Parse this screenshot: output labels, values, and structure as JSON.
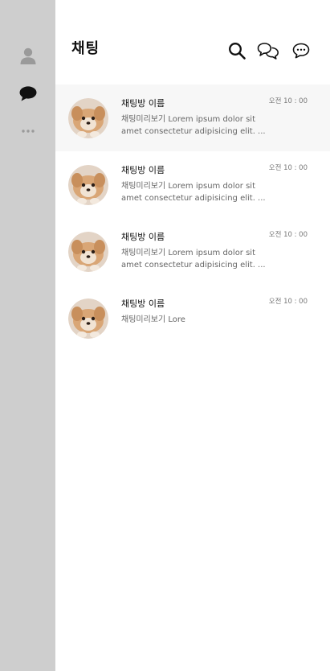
{
  "colors": {
    "sidebar_bg": "#cecece",
    "active_row_bg": "#f7f7f7",
    "icon_inactive": "#9a9a9a",
    "icon_active": "#111111"
  },
  "sidebar": {
    "items": [
      {
        "name": "friends",
        "icon": "person-icon",
        "active": false
      },
      {
        "name": "chats",
        "icon": "chat-bubble-icon",
        "active": true
      },
      {
        "name": "more",
        "icon": "more-dots-icon",
        "active": false
      }
    ]
  },
  "header": {
    "title": "채팅",
    "actions": [
      {
        "name": "search",
        "icon": "search-icon"
      },
      {
        "name": "open-chat",
        "icon": "open-chat-icon"
      },
      {
        "name": "new-chat",
        "icon": "new-chat-icon"
      }
    ]
  },
  "chats": [
    {
      "name": "채팅방 이름",
      "time": "오전 10 : 00",
      "preview": "채팅미리보기 Lorem ipsum dolor sit amet consectetur adipisicing elit. ...",
      "active": true
    },
    {
      "name": "채팅방 이름",
      "time": "오전 10 : 00",
      "preview": "채팅미리보기 Lorem ipsum dolor sit amet consectetur adipisicing elit. ...",
      "active": false
    },
    {
      "name": "채팅방 이름",
      "time": "오전 10 : 00",
      "preview": "채팅미리보기 Lorem ipsum dolor sit amet consectetur adipisicing elit. ...",
      "active": false
    },
    {
      "name": "채팅방 이름",
      "time": "오전 10 : 00",
      "preview": "채팅미리보기 Lore",
      "active": false
    }
  ]
}
